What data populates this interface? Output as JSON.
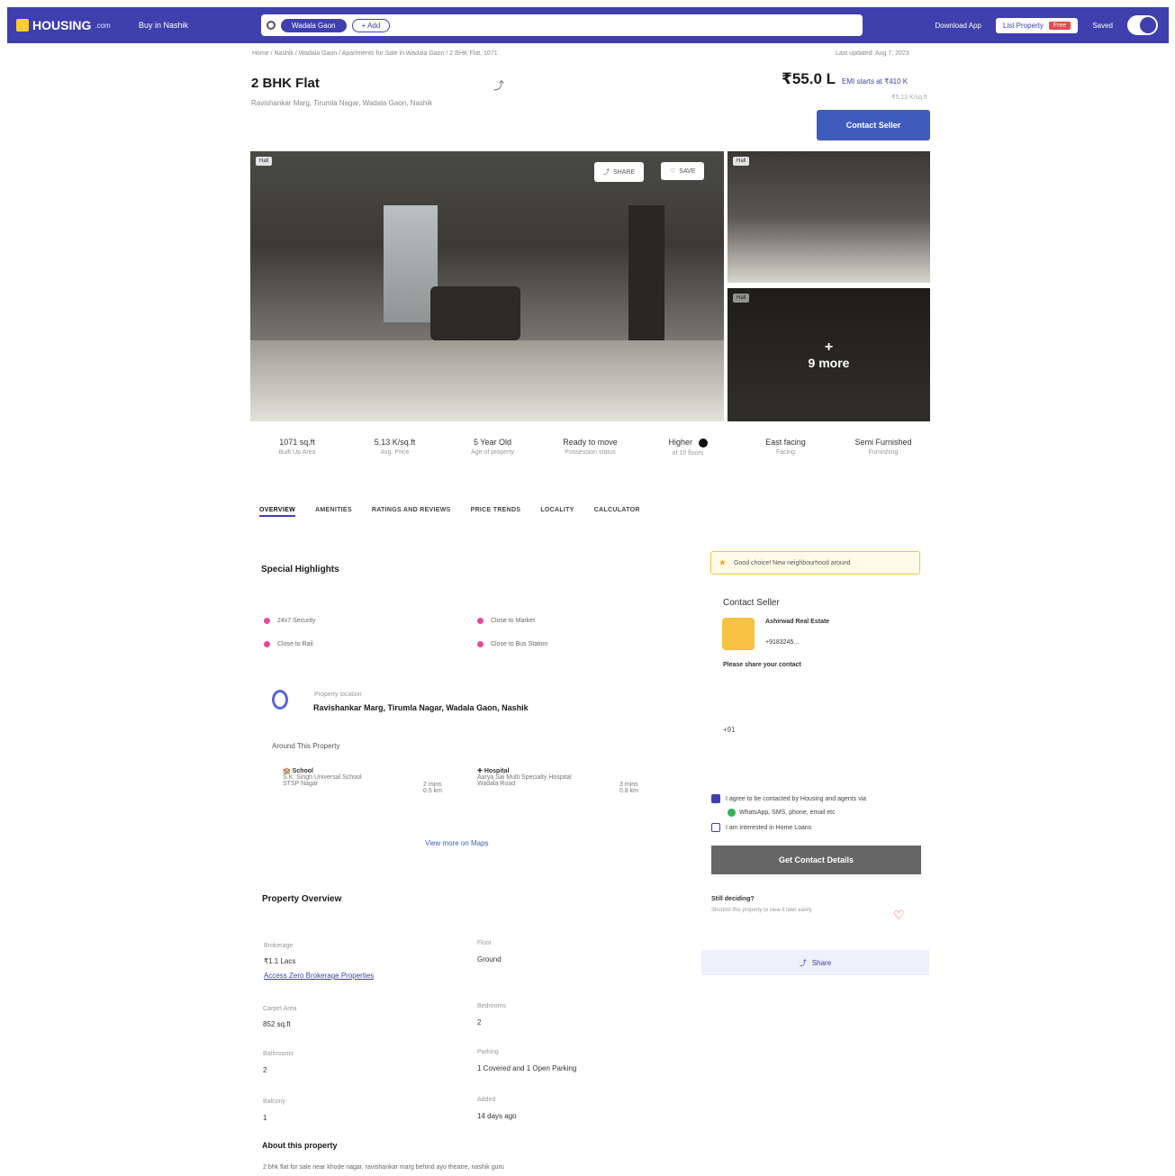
{
  "nav": {
    "logo": "HOUSING",
    "logo_suffix": ".com",
    "city": "Buy in Nashik",
    "chip": "Wadala Gaon",
    "chip_add": "+ Add",
    "download_app": "Download App",
    "list_property": "List Property",
    "free": "Free",
    "saved": "Saved"
  },
  "breadcrumb": "Home / Nashik / Wadala Gaon / Apartments for Sale in Wadala Gaon / 2 BHK Flat, 1071",
  "updated": "Last updated: Aug 7, 2023",
  "listing": {
    "title": "2 BHK Flat",
    "address_sub": "Ravishankar Marg, Tirumla Nagar, Wadala Gaon, Nashik",
    "price": "₹55.0 L",
    "emi": "EMI starts at ₹410 K",
    "price_sub": "₹5.13 K/sq.ft",
    "contact_button": "Contact Seller"
  },
  "gallery": {
    "main_tag": "Hall",
    "share": "SHARE",
    "save": "SAVE",
    "side1_tag": "Hall",
    "side2_tag": "Hall",
    "more": "9 more"
  },
  "stats": [
    {
      "value": "1071 sq.ft",
      "label": "Built Up Area"
    },
    {
      "value": "5.13 K/sq.ft",
      "label": "Avg. Price"
    },
    {
      "value": "5 Year Old",
      "label": "Age of property"
    },
    {
      "value": "Ready to move",
      "label": "Possession status"
    },
    {
      "value": "Higher",
      "label": "of 10 floors"
    },
    {
      "value": "East facing",
      "label": "Facing"
    },
    {
      "value": "Semi Furnished",
      "label": "Furnishing"
    }
  ],
  "tabs": [
    "OVERVIEW",
    "AMENITIES",
    "RATINGS AND REVIEWS",
    "PRICE TRENDS",
    "LOCALITY",
    "CALCULATOR"
  ],
  "highlights": {
    "title": "Special Highlights",
    "items": [
      "24x7 Security",
      "Close to Market",
      "Close to Rail",
      "Close to Bus Station"
    ]
  },
  "location": {
    "label": "Property location",
    "address": "Ravishankar Marg, Tirumla Nagar, Wadala Gaon, Nashik",
    "around": "Around This Property",
    "poi": [
      {
        "type": "School",
        "name": "S.K. Singh Universal School",
        "sub": "STSP Nagar",
        "distance": "2 mins",
        "dist_sub": "0.5 km"
      },
      {
        "type": "Hospital",
        "name": "Aarya Sai Multi Specialty Hospital",
        "sub": "Wadala Road",
        "distance": "3 mins",
        "dist_sub": "0.8 km"
      }
    ],
    "view_more": "View more on Maps"
  },
  "overview": {
    "title": "Property Overview",
    "brokerage_label": "Brokerage",
    "brokerage_value": "₹1.1 Lacs",
    "floor_label": "Floor",
    "floor_value": "Ground",
    "brokerage_link": "Access Zero Brokerage Properties",
    "carpet_label": "Carpet Area",
    "carpet_value": "852 sq.ft",
    "bedrooms_label": "Bedrooms",
    "bedrooms_value": "2",
    "bathrooms_label": "Bathrooms",
    "bathrooms_value": "2",
    "parking_label": "Parking",
    "parking_value": "1 Covered and 1 Open Parking",
    "balcony_label": "Balcony",
    "balcony_value": "1",
    "added_label": "Added",
    "added_value": "14 days ago",
    "about_title": "About this property",
    "about_text": "2 bhk flat for sale near khode nagar, ravishankar marg behind ayo theatre, nashik guru"
  },
  "sidebar": {
    "good_choice": "Good choice! New neighbourhood around",
    "contact_title": "Contact Seller",
    "seller_name": "Ashirwad Real Estate",
    "seller_phone": "+9183245...",
    "share_contact": "Please share your contact",
    "phone_code": "+91",
    "consent": "I agree to be contacted by Housing and agents via",
    "whatsapp": "WhatsApp, SMS, phone, email etc",
    "interested": "I am interested in Home Loans",
    "get_contact": "Get Contact Details",
    "still_deciding": "Still deciding?",
    "still_sub": "Shortlist this property to view it later easily",
    "share": "Share"
  }
}
